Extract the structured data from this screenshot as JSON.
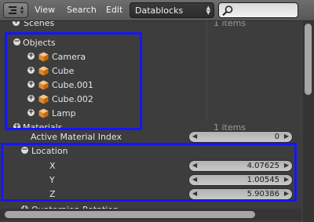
{
  "header": {
    "menus": [
      "View",
      "Search",
      "Edit"
    ],
    "display_mode": "Datablocks",
    "search": {
      "value": ""
    }
  },
  "outliner": {
    "top_partial": {
      "label": "Scenes",
      "count": "1 items"
    },
    "objects": {
      "label": "Objects",
      "expanded": true,
      "items": [
        {
          "label": "Camera",
          "icon": "cube-icon"
        },
        {
          "label": "Cube",
          "icon": "cube-icon"
        },
        {
          "label": "Cube.001",
          "icon": "cube-icon"
        },
        {
          "label": "Cube.002",
          "icon": "cube-icon"
        },
        {
          "label": "Lamp",
          "icon": "cube-icon"
        }
      ]
    },
    "materials_partial": {
      "label": "Materials",
      "count": "1 items"
    },
    "active_material_index": {
      "label": "Active Material Index",
      "value": "0"
    },
    "location": {
      "label": "Location",
      "x": {
        "label": "X",
        "value": "4.07625"
      },
      "y": {
        "label": "Y",
        "value": "1.00545"
      },
      "z": {
        "label": "Z",
        "value": "5.90386"
      }
    },
    "bottom_partial": {
      "label": "Quaternion Rotation"
    }
  },
  "colors": {
    "highlight": "#1515ff",
    "background": "#3d3d3d",
    "header": "#606060"
  }
}
